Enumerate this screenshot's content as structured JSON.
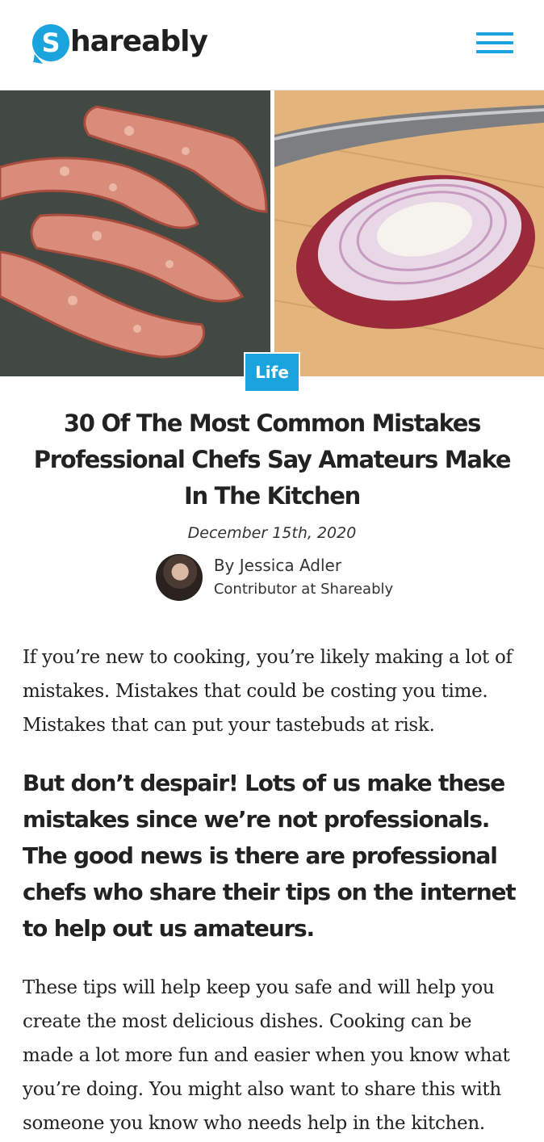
{
  "header": {
    "logo_letter": "S",
    "logo_text": "hareably",
    "brand_color": "#1aa3dd"
  },
  "hero": {
    "left_image": "bacon frying in pan",
    "right_image": "halved red onion and knife on cutting board",
    "category": "Life"
  },
  "article": {
    "title": "30 Of The Most Common Mistakes Professional Chefs Say Amateurs Make In The Kitchen",
    "date": "December 15th, 2020",
    "author_name": "By Jessica Adler",
    "author_role": "Contributor at Shareably",
    "paragraph_1": "If you’re new to cooking, you’re likely making a lot of mistakes. Mistakes that could be costing you time. Mistakes that can put your tastebuds at risk.",
    "lead": "But don’t despair! Lots of us make these mistakes since we’re not professionals. The good news is there are professional chefs who share their tips on the internet to help out us amateurs.",
    "paragraph_2": "These tips will help keep you safe and will help you create the most delicious dishes. Cooking can be made a lot more fun and easier when you know what you’re doing. You might also want to share this with someone you know who needs help in the kitchen."
  }
}
